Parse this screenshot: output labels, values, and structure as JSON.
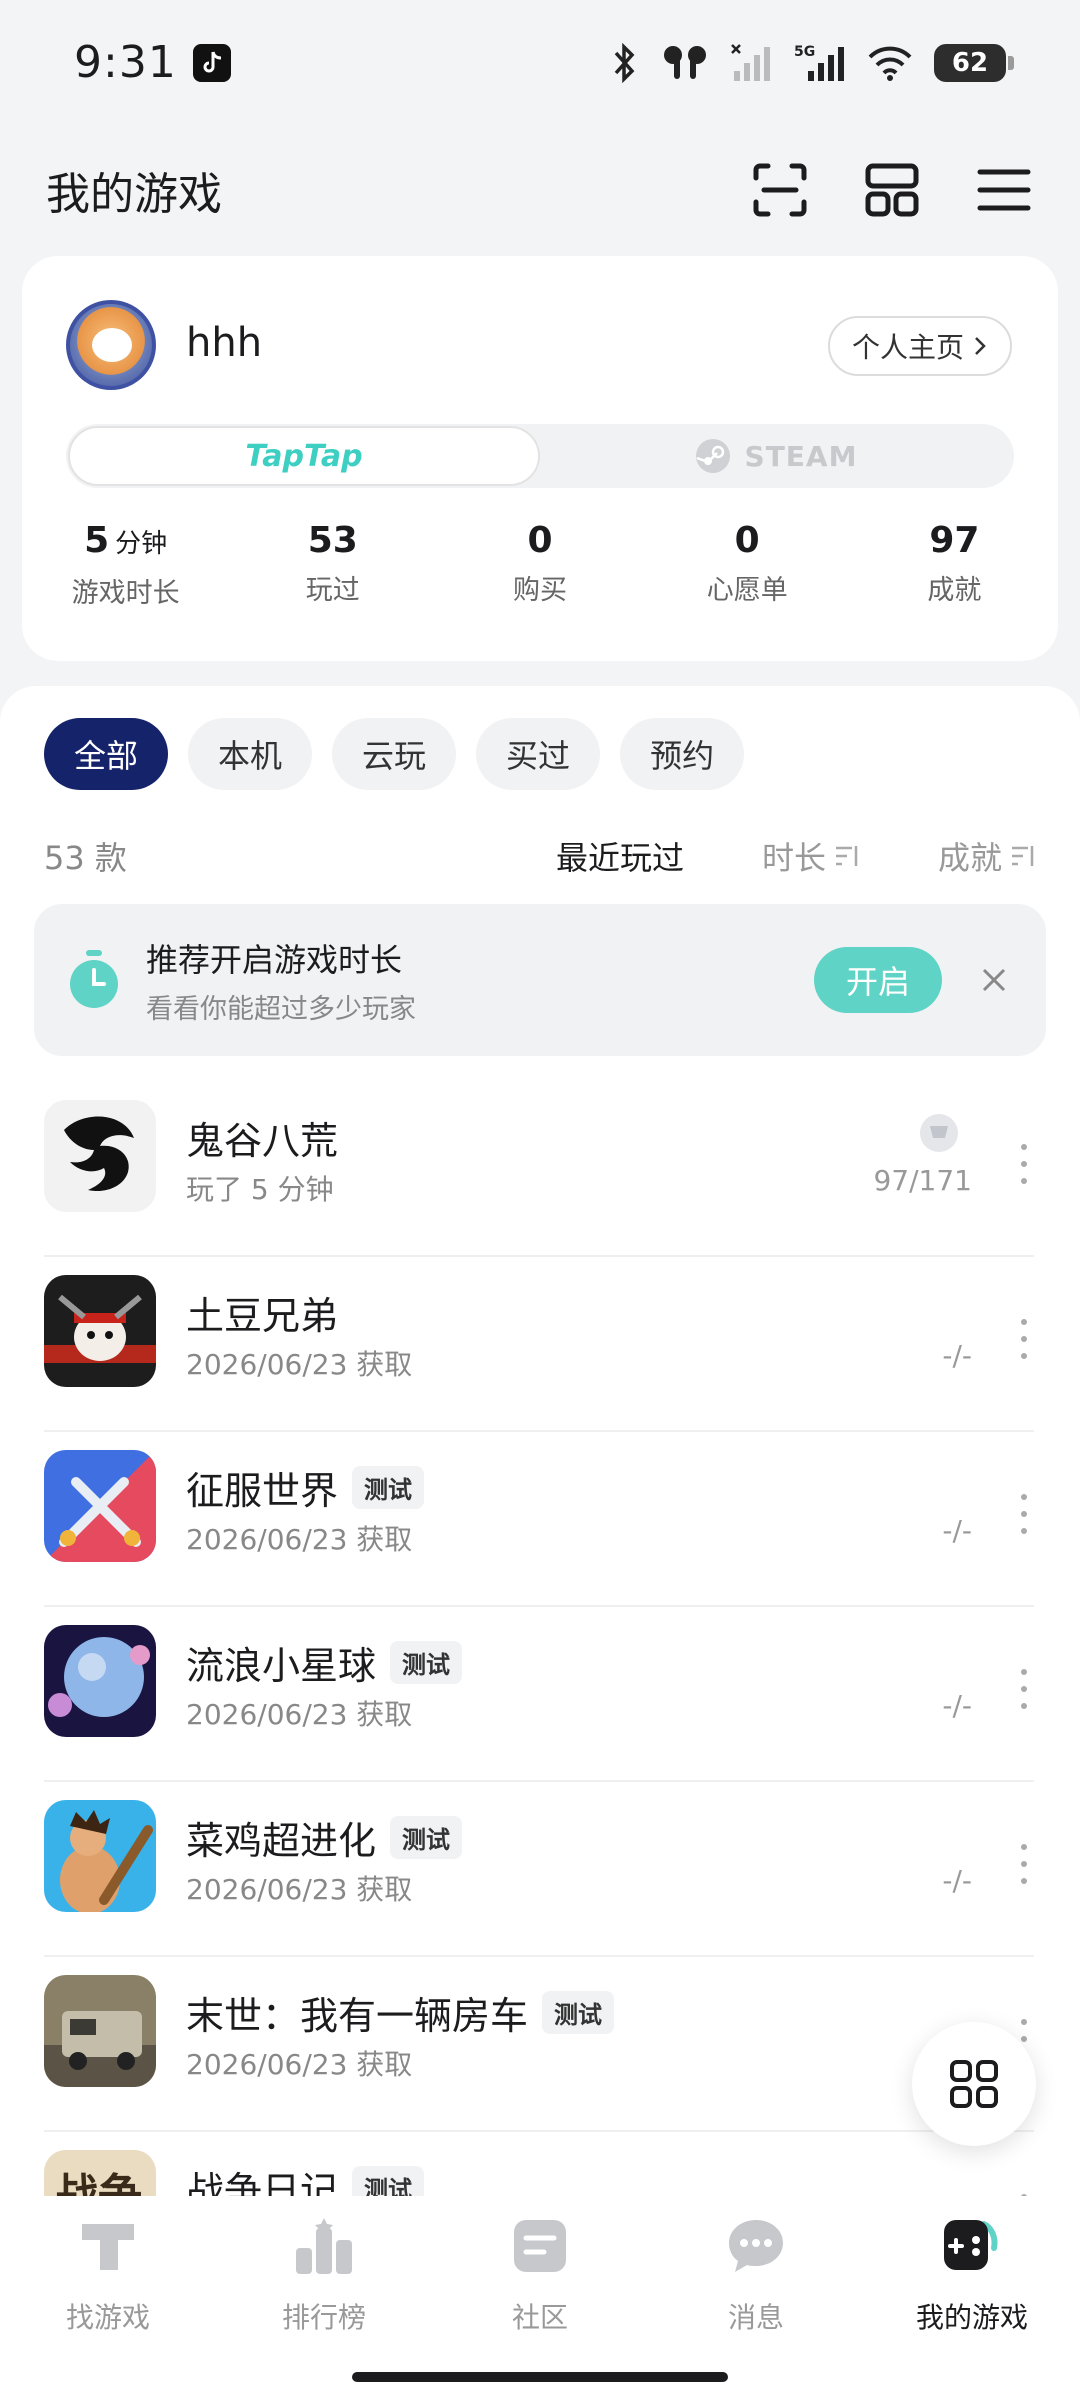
{
  "status": {
    "time": "9:31",
    "battery": "62",
    "network": "5G"
  },
  "header": {
    "title": "我的游戏"
  },
  "profile": {
    "username": "hhh",
    "homepage_label": "个人主页",
    "platforms": {
      "taptap": "TapTap",
      "steam": "STEAM"
    },
    "stats": [
      {
        "value": "5",
        "unit": "分钟",
        "label": "游戏时长"
      },
      {
        "value": "53",
        "unit": "",
        "label": "玩过"
      },
      {
        "value": "0",
        "unit": "",
        "label": "购买"
      },
      {
        "value": "0",
        "unit": "",
        "label": "心愿单"
      },
      {
        "value": "97",
        "unit": "",
        "label": "成就"
      }
    ]
  },
  "filters": [
    "全部",
    "本机",
    "云玩",
    "买过",
    "预约"
  ],
  "list": {
    "count": "53 款",
    "sorts": [
      "最近玩过",
      "时长",
      "成就"
    ]
  },
  "banner": {
    "title": "推荐开启游戏时长",
    "subtitle": "看看你能超过多少玩家",
    "button": "开启"
  },
  "games": [
    {
      "name": "鬼谷八荒",
      "tag": "",
      "sub": "玩了 5 分钟",
      "achievement": "97/171"
    },
    {
      "name": "土豆兄弟",
      "tag": "",
      "sub": "2026/06/23 获取",
      "achievement": "-/-"
    },
    {
      "name": "征服世界",
      "tag": "测试",
      "sub": "2026/06/23 获取",
      "achievement": "-/-"
    },
    {
      "name": "流浪小星球",
      "tag": "测试",
      "sub": "2026/06/23 获取",
      "achievement": "-/-"
    },
    {
      "name": "菜鸡超进化",
      "tag": "测试",
      "sub": "2026/06/23 获取",
      "achievement": "-/-"
    },
    {
      "name": "末世：我有一辆房车",
      "tag": "测试",
      "sub": "2026/06/23 获取",
      "achievement": ""
    },
    {
      "name": "战争日记",
      "tag": "测试",
      "sub": "",
      "achievement": ""
    }
  ],
  "nav": [
    {
      "label": "找游戏",
      "icon": "find-games-icon"
    },
    {
      "label": "排行榜",
      "icon": "leaderboard-icon"
    },
    {
      "label": "社区",
      "icon": "community-icon"
    },
    {
      "label": "消息",
      "icon": "messages-icon"
    },
    {
      "label": "我的游戏",
      "icon": "my-games-icon"
    }
  ],
  "colors": {
    "accent": "#15236a",
    "teal": "#5fd4c6",
    "taptap": "#3ccfc2"
  }
}
